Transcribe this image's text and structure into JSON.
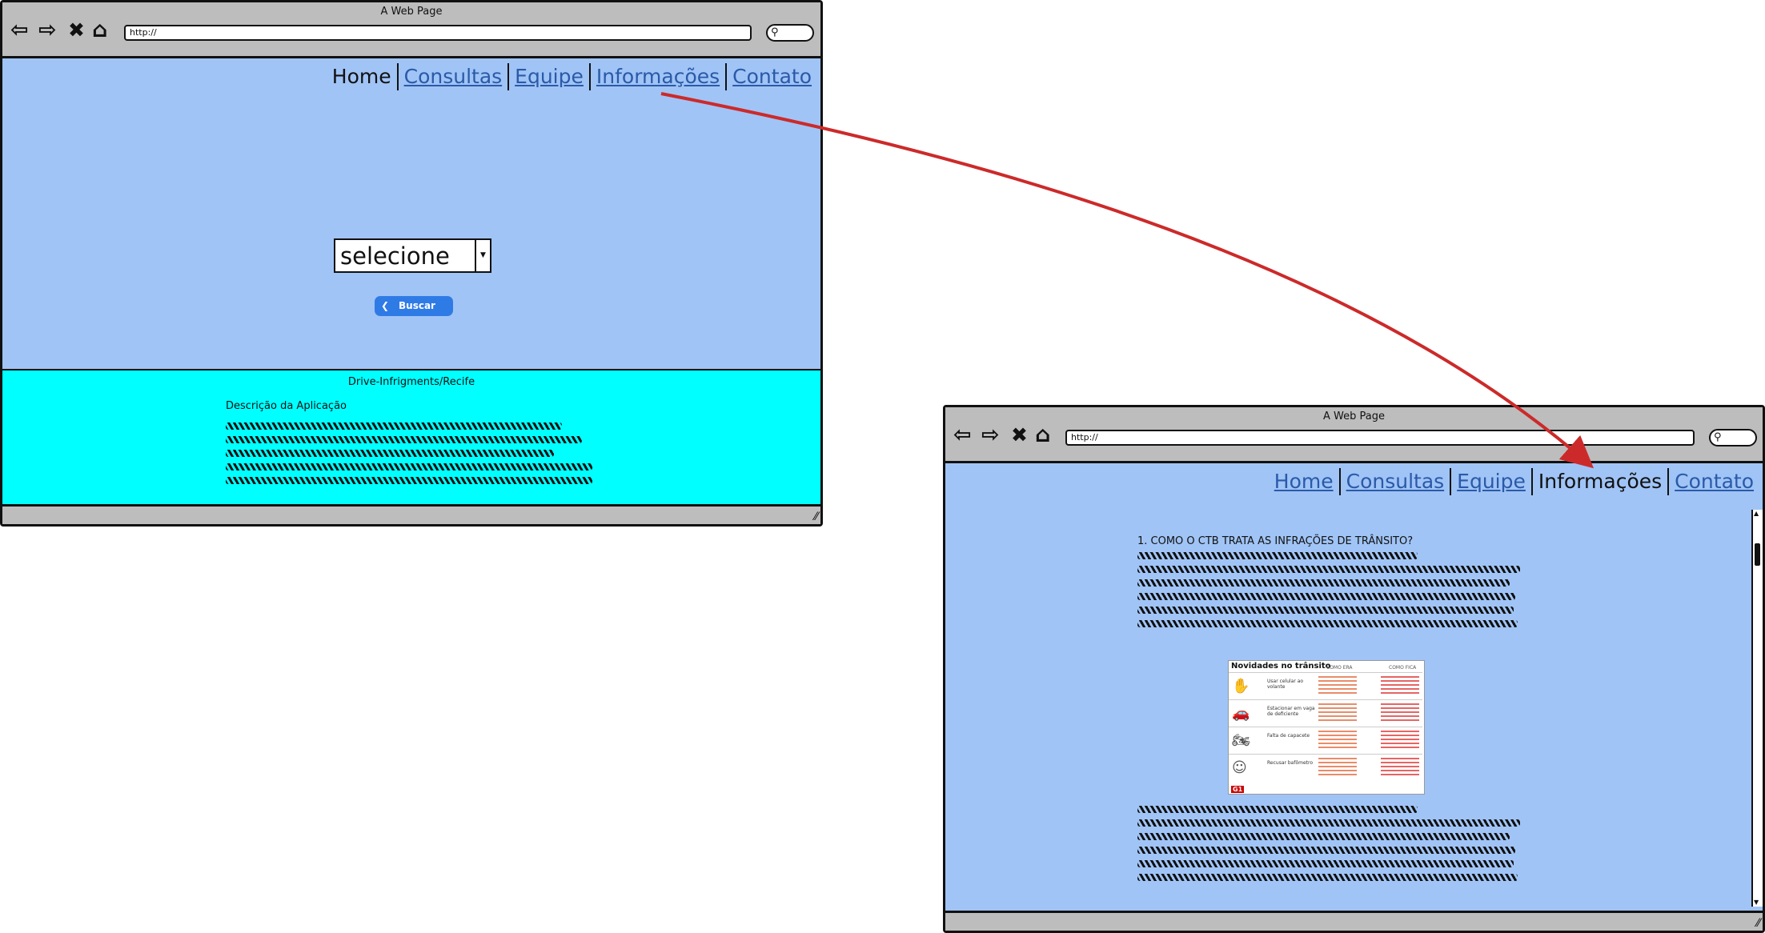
{
  "screen_home": {
    "window_title": "A Web Page",
    "url": "http://",
    "menu": {
      "home": "Home",
      "consultas": "Consultas",
      "equipe": "Equipe",
      "informacoes": "Informações",
      "contato": "Contato"
    },
    "select": {
      "value": "selecione"
    },
    "search_button": "Buscar",
    "footer": {
      "title": "Drive-Infrigments/Recife",
      "subtitle": "Descrição da Aplicação"
    }
  },
  "screen_info": {
    "window_title": "A Web Page",
    "url": "http://",
    "menu": {
      "home": "Home",
      "consultas": "Consultas",
      "equipe": "Equipe",
      "informacoes": "Informações",
      "contato": "Contato"
    },
    "section_heading": "1. COMO O CTB TRATA AS INFRAÇÕES DE TRÂNSITO?",
    "figure": {
      "title": "Novidades no trânsito",
      "col_before": "COMO ERA",
      "col_after": "COMO FICA",
      "rows": [
        "Usar celular ao volante",
        "Estacionar em vaga de deficiente",
        "Falta de capacete",
        "Recusar bafômetro"
      ],
      "logo": "G1"
    }
  },
  "colors": {
    "page_bg": "#a0c4f6",
    "footer_bg": "#00ffff",
    "link": "#2a5aa8",
    "button": "#2f7be6",
    "arrow": "#cc2a2a"
  },
  "icons": [
    "back-arrow-icon",
    "forward-arrow-icon",
    "close-icon",
    "home-icon",
    "search-icon",
    "chevron-left-icon",
    "chevron-down-icon",
    "resize-grip-icon"
  ]
}
